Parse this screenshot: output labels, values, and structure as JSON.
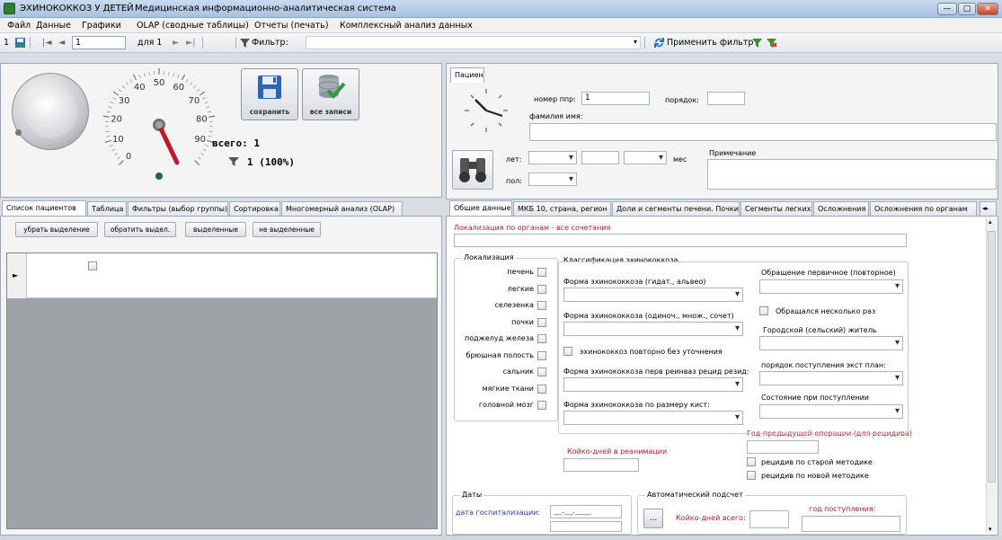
{
  "window": {
    "title": "ЭХИНОКОККОЗ У ДЕТЕЙ",
    "subtitle": "Медицинская информационно-аналитическая система",
    "minimize": "—",
    "maximize": "▢",
    "close": "✕"
  },
  "menu": [
    "Файл",
    "Данные",
    "Графики",
    "OLAP (сводные таблицы)",
    "Отчеты (печать)",
    "Комплексный анализ данных"
  ],
  "toolbar": {
    "record_left": "1",
    "record_current": "1",
    "record_of": "для 1",
    "filter_label": "Фильтр:",
    "apply_filter": "Применить фильтр",
    "nav_first": "|◄",
    "nav_prev": "◄",
    "nav_next": "►",
    "nav_last": "►|"
  },
  "gauge": {
    "ticks": [
      "0",
      "10",
      "20",
      "30",
      "40",
      "50",
      "60",
      "70",
      "80",
      "90"
    ],
    "value": 100
  },
  "buttons": {
    "save": "сохранить",
    "all_records": "все записи"
  },
  "summary": {
    "total_label": "всего: 1",
    "filtered": "1 (100%)"
  },
  "left_tabs": [
    "Список пациентов",
    "Таблица",
    "Фильтры (выбор группы)",
    "Сортировка",
    "Многомерный анализ (OLAP)"
  ],
  "list_buttons": [
    "убрать выделение",
    "обратить выдел.",
    "выделенные",
    "не выделенные"
  ],
  "grid": {
    "row_marker": "►"
  },
  "patient": {
    "tab": "Пациент",
    "number_label": "номер ппр:",
    "number_value": "1",
    "order_label": "порядок:",
    "name_label": "фамилия имя:",
    "age_label": "лет:",
    "month_label": "мес",
    "sex_label": "пол:",
    "note_label": "Примечание"
  },
  "detail_tabs": [
    "Общие данные",
    "МКБ 10, страна, регион",
    "Доли и сегменты печени. Почки.",
    "Сегменты легких",
    "Осложнения",
    "Осложнения по органам"
  ],
  "detail": {
    "localization_header": "Локализация по органам - все сочетания",
    "loc_group": "Локализация",
    "organs": [
      "печень",
      "легкие",
      "селезенка",
      "почки",
      "поджелуд железа",
      "брюшная полость",
      "сальник",
      "мягкие ткани",
      "головной мозг"
    ],
    "class_group": "Классификация эхинококкоза",
    "form_type": "Форма эхинококкоза (гидат., альвео)",
    "form_count": "Форма эхинококкоза (одиноч., множ., сочет)",
    "repeat_unspecified": "эхинококкоз повторно без уточнения",
    "form_relapse": "Форма эхинококкоза перв реинваз рецид резид:",
    "form_size": "Форма эхинококкоза по размеру кист:",
    "icu_days": "Койко-дней в реанимации",
    "visit_type": "Обращение первичное (повторное)",
    "repeat_visits": "Обращался несколько раз",
    "resident": "Городской (сельский) житель",
    "admission_order": "порядок поступления экст план:",
    "admission_state": "Состояние при поступлении",
    "prev_op_year": "Год предыдущей операции (для рецидива)",
    "relapse_old": "рецидив по старой методике",
    "relapse_new": "рецидив по новой методике",
    "dates_group": "Даты",
    "hosp_date": "дата госпитализации:",
    "date_placeholder": "__.__.____",
    "auto_group": "Автоматический подсчет",
    "bed_days_total": "Койко-дней всего:",
    "year_admission": "год поступления:",
    "calc_button": "..."
  },
  "colors": {
    "titlebar": "#b4c9e3",
    "accent_red": "#b0202a",
    "accent_blue": "#2c3e9a",
    "gauge_needle": "#c0182b",
    "funnel_green": "#3e8e2f"
  }
}
